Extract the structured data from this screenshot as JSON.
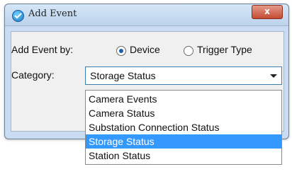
{
  "window": {
    "title": "Add Event",
    "close_label": "x"
  },
  "form": {
    "add_event_by_label": "Add Event by:",
    "radio_device_label": "Device",
    "radio_trigger_type_label": "Trigger Type",
    "selected_radio": "Device",
    "category_label": "Category:",
    "category_selected": "Storage Status"
  },
  "dropdown": {
    "options": [
      "Camera Events",
      "Camera Status",
      "Substation Connection Status",
      "Storage Status",
      "Station Status"
    ],
    "highlighted_index": 3
  },
  "colors": {
    "highlight": "#3399ff",
    "window_frame": "#c9dcf2",
    "close_button": "#c44b34"
  },
  "icons": {
    "app": "check-circle-icon",
    "close": "close-icon",
    "dropdown": "chevron-down-icon"
  }
}
